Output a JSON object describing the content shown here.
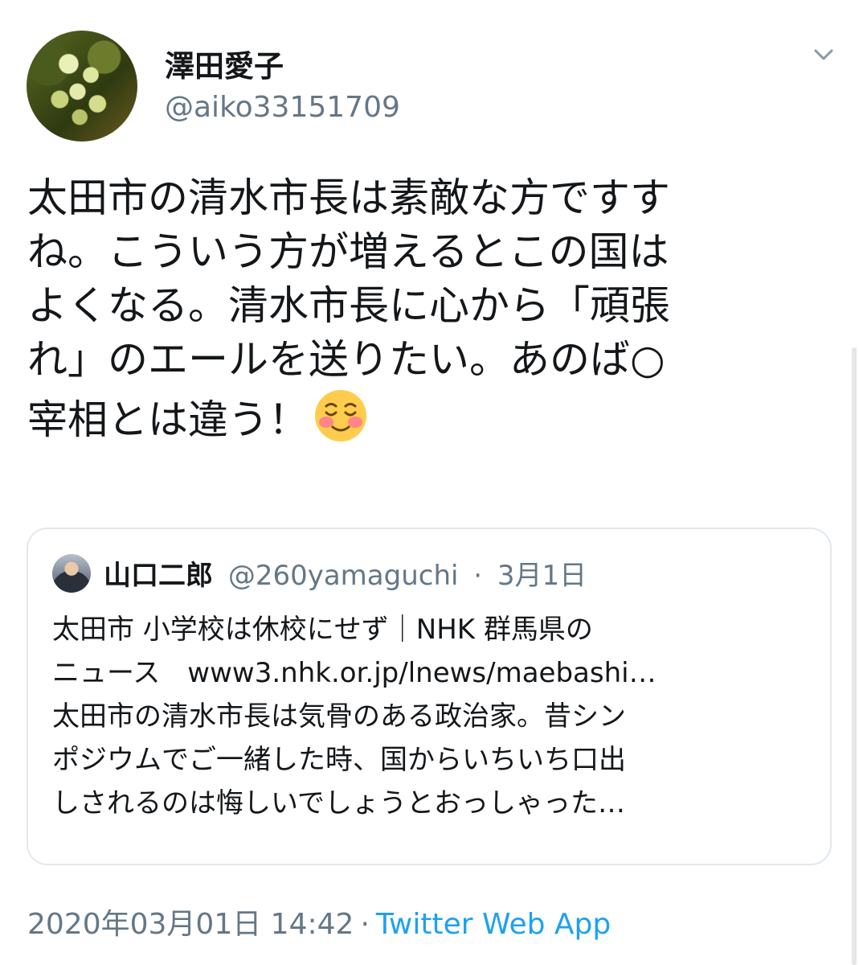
{
  "author": {
    "display_name": "澤田愛子",
    "handle": "@aiko33151709"
  },
  "tweet": {
    "lines": [
      "太田市の清水市長は素敵な方ですす",
      "ね。こういう方が増えるとこの国は",
      "よくなる。清水市長に心から「頑張",
      "れ」のエールを送りたい。あのば○",
      "宰相とは違う！"
    ],
    "emoji": "smiling-face-with-blush"
  },
  "quoted": {
    "name": "山口二郎",
    "handle": "@260yamaguchi",
    "separator": "·",
    "date": "3月1日",
    "lines": [
      "太田市 小学校は休校にせず｜NHK 群馬県の",
      "ニュース　www3.nhk.or.jp/lnews/maebashi…",
      "太田市の清水市長は気骨のある政治家。昔シン",
      "ポジウムでご一緒した時、国からいちいち口出",
      "しされるのは悔しいでしょうとおっしゃった…"
    ]
  },
  "footer": {
    "timestamp": "2020年03月01日 14:42",
    "separator": "·",
    "source": "Twitter Web App"
  },
  "icons": {
    "more": "chevron-down-icon"
  }
}
